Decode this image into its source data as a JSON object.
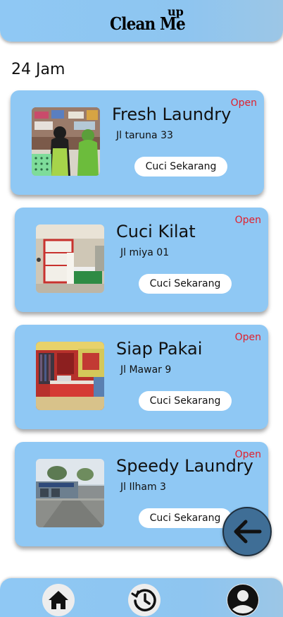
{
  "header": {
    "logo_main": "Clean Me",
    "logo_sup": "up"
  },
  "section": {
    "title": "24 Jam"
  },
  "cards": [
    {
      "name": "Fresh Laundry",
      "address": "Jl taruna 33",
      "status": "Open",
      "button_label": "Cuci Sekarang"
    },
    {
      "name": "Cuci Kilat",
      "address": "Jl miya 01",
      "status": "Open",
      "button_label": "Cuci Sekarang"
    },
    {
      "name": "Siap Pakai",
      "address": "Jl Mawar 9",
      "status": "Open",
      "button_label": "Cuci Sekarang"
    },
    {
      "name": "Speedy Laundry",
      "address": "Jl Ilham 3",
      "status": "Open",
      "button_label": "Cuci Sekarang"
    }
  ],
  "fab": {
    "icon": "arrow-left-icon"
  },
  "bottom_nav": {
    "items": [
      {
        "icon": "home-icon"
      },
      {
        "icon": "history-icon"
      },
      {
        "icon": "profile-icon"
      }
    ]
  },
  "colors": {
    "primary": "#8fc8f4",
    "status_open": "#e0202d",
    "fab": "#3f6e96"
  }
}
